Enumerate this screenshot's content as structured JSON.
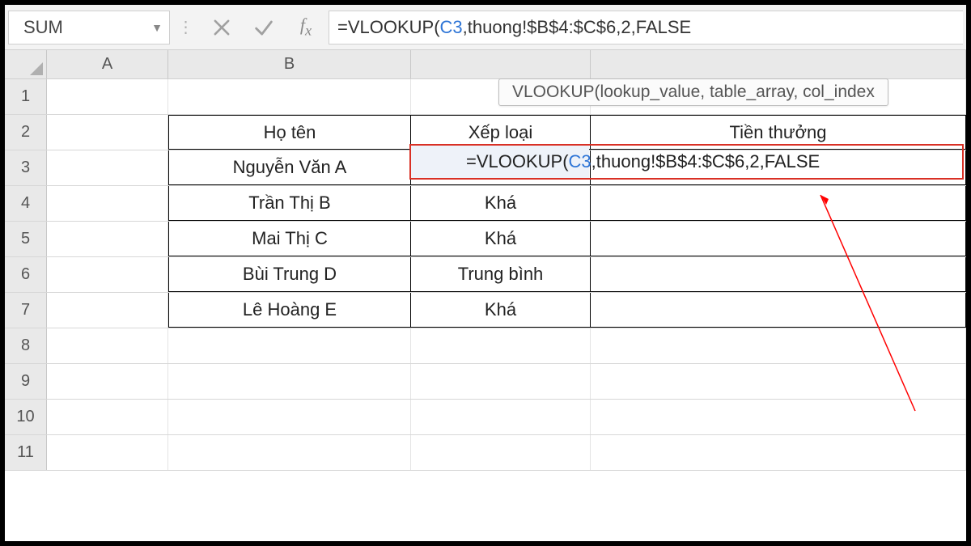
{
  "name_box": "SUM",
  "formula_bar": {
    "prefix": "=VLOOKUP(",
    "ref": "C3",
    "suffix": ",thuong!$B$4:$C$6,2,FALSE"
  },
  "tooltip": "VLOOKUP(lookup_value, table_array, col_index",
  "columns": [
    "A",
    "B"
  ],
  "rows": [
    "1",
    "2",
    "3",
    "4",
    "5",
    "6",
    "7",
    "8",
    "9",
    "10",
    "11"
  ],
  "table": {
    "headers": {
      "b": "Họ tên",
      "c": "Xếp loại",
      "d": "Tiền thưởng"
    },
    "data": [
      {
        "b": "Nguyễn Văn A",
        "c": "",
        "d": ""
      },
      {
        "b": "Trần Thị B",
        "c": "Khá",
        "d": ""
      },
      {
        "b": "Mai Thị C",
        "c": "Khá",
        "d": ""
      },
      {
        "b": "Bùi Trung D",
        "c": "Trung bình",
        "d": ""
      },
      {
        "b": "Lê Hoàng E",
        "c": "Khá",
        "d": ""
      }
    ]
  },
  "inline_formula": {
    "prefix": "=VLOOKUP(",
    "ref": "C3",
    "suffix": ",thuong!$B$4:$C$6,2,FALSE"
  }
}
